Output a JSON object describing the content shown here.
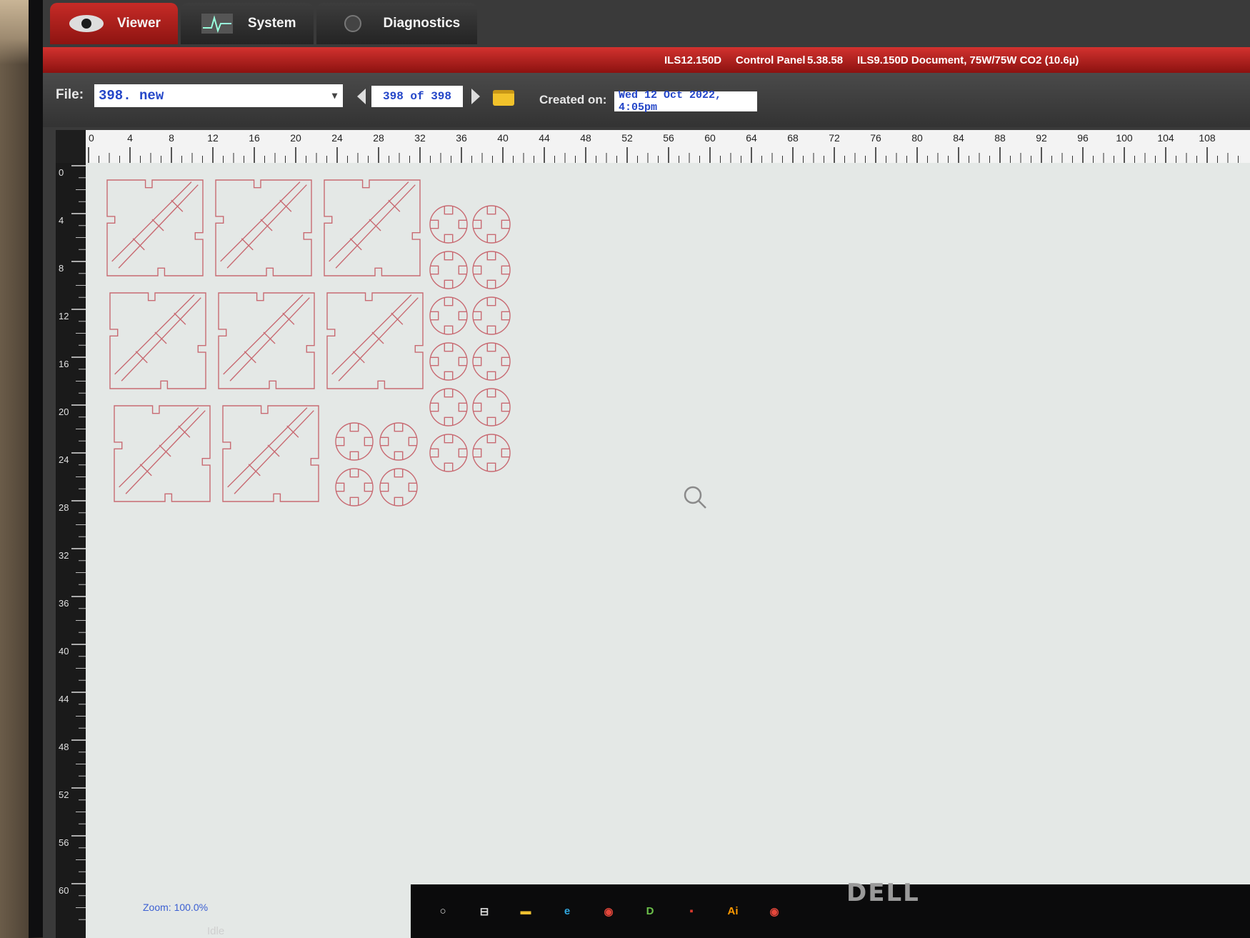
{
  "tabs": [
    {
      "label": "Viewer",
      "icon": "eye-icon"
    },
    {
      "label": "System",
      "icon": "pulse-icon"
    },
    {
      "label": "Diagnostics",
      "icon": "stethoscope-icon"
    }
  ],
  "header_info": {
    "model": "ILS12.150D",
    "control_panel": "Control Panel",
    "version": "5.38.58",
    "document": "ILS9.150D Document, 75W/75W CO2 (10.6µ)"
  },
  "toolbar": {
    "file_label": "File:",
    "file_value": "398. new",
    "page_counter": "398 of 398",
    "created_label": "Created on:",
    "created_value": "Wed 12 Oct 2022,  4:05pm"
  },
  "ruler": {
    "h_labels": [
      "0",
      "4",
      "8",
      "12",
      "16",
      "20",
      "24",
      "28",
      "32",
      "36",
      "40",
      "44",
      "48",
      "52",
      "56",
      "60",
      "64",
      "68",
      "72",
      "76",
      "80",
      "84",
      "88",
      "92",
      "96",
      "100",
      "104",
      "108"
    ],
    "v_labels": [
      "0",
      "4",
      "8",
      "12",
      "16",
      "20",
      "24",
      "28",
      "32",
      "36",
      "40",
      "44",
      "48",
      "52",
      "56",
      "60"
    ]
  },
  "footer": {
    "zoom": "Zoom:  100.0%",
    "status": "Idle"
  },
  "taskbar": [
    {
      "name": "search-circle-icon",
      "glyph": "○",
      "color": "#dddddd"
    },
    {
      "name": "task-view-icon",
      "glyph": "⊟",
      "color": "#dddddd"
    },
    {
      "name": "file-explorer-icon",
      "glyph": "▬",
      "color": "#f0c030"
    },
    {
      "name": "edge-icon",
      "glyph": "e",
      "color": "#31a8e0"
    },
    {
      "name": "chrome-icon",
      "glyph": "◉",
      "color": "#e5473b"
    },
    {
      "name": "app-d-icon",
      "glyph": "D",
      "color": "#6cc04a"
    },
    {
      "name": "pdf-icon",
      "glyph": "▪",
      "color": "#d83a2e"
    },
    {
      "name": "illustrator-icon",
      "glyph": "Ai",
      "color": "#ff9a00"
    },
    {
      "name": "chrome-2-icon",
      "glyph": "◉",
      "color": "#e5473b"
    }
  ],
  "brand": "DELL",
  "colors": {
    "accent": "#b51d1a",
    "cut_line": "#c86a72",
    "field_text": "#2446c8"
  }
}
